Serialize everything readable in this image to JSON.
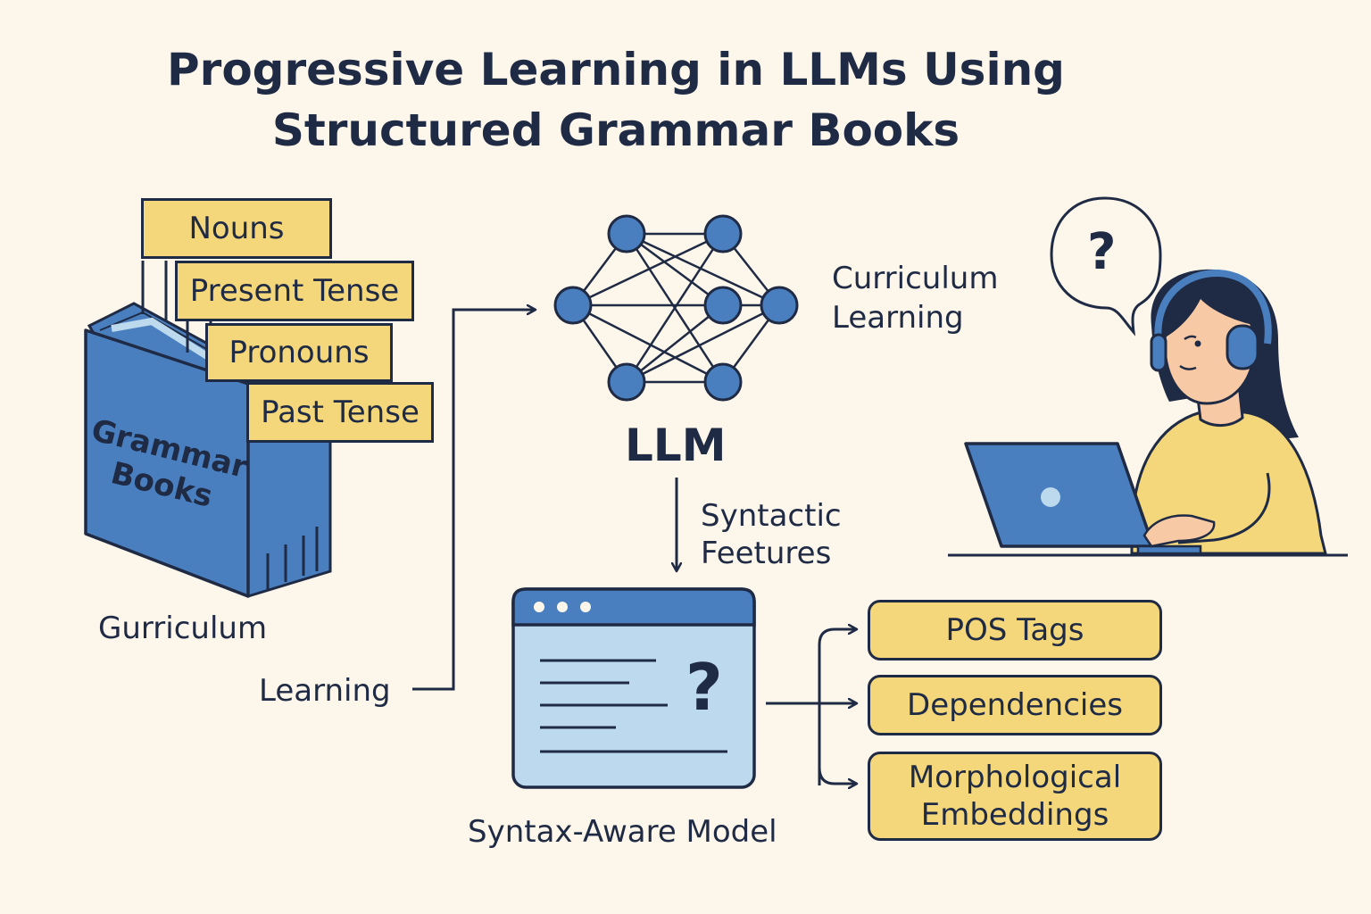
{
  "title": {
    "line1": "Progressive Learning in LLMs Using",
    "line2": "Structured Grammar Books"
  },
  "book": {
    "cover_line1": "Grammar",
    "cover_line2": "Books",
    "tabs": [
      "Nouns",
      "Present Tense",
      "Pronouns",
      "Past Tense"
    ],
    "caption": "Gurriculum"
  },
  "flow": {
    "learning_label": "Learning",
    "llm_label": "LLM",
    "curriculum_line1": "Curriculum",
    "curriculum_line2": "Learning",
    "syntactic_line1": "Syntactic",
    "syntactic_line2": "Feetures"
  },
  "model": {
    "caption": "Syntax-Aware Model",
    "question_mark": "?"
  },
  "outputs": {
    "pos": "POS Tags",
    "dependencies": "Dependencies",
    "morph_line1": "Morphological",
    "morph_line2": "Embeddings"
  },
  "person": {
    "speech_bubble": "?"
  },
  "colors": {
    "background": "#fdf6ea",
    "ink": "#1f2a44",
    "blue": "#4a7fbf",
    "light_blue": "#bcd9ee",
    "yellow": "#f4d77a"
  },
  "icons": [
    "network-icon",
    "window-icon",
    "book-icon",
    "laptop-icon",
    "headphones-icon",
    "speech-bubble-icon"
  ]
}
